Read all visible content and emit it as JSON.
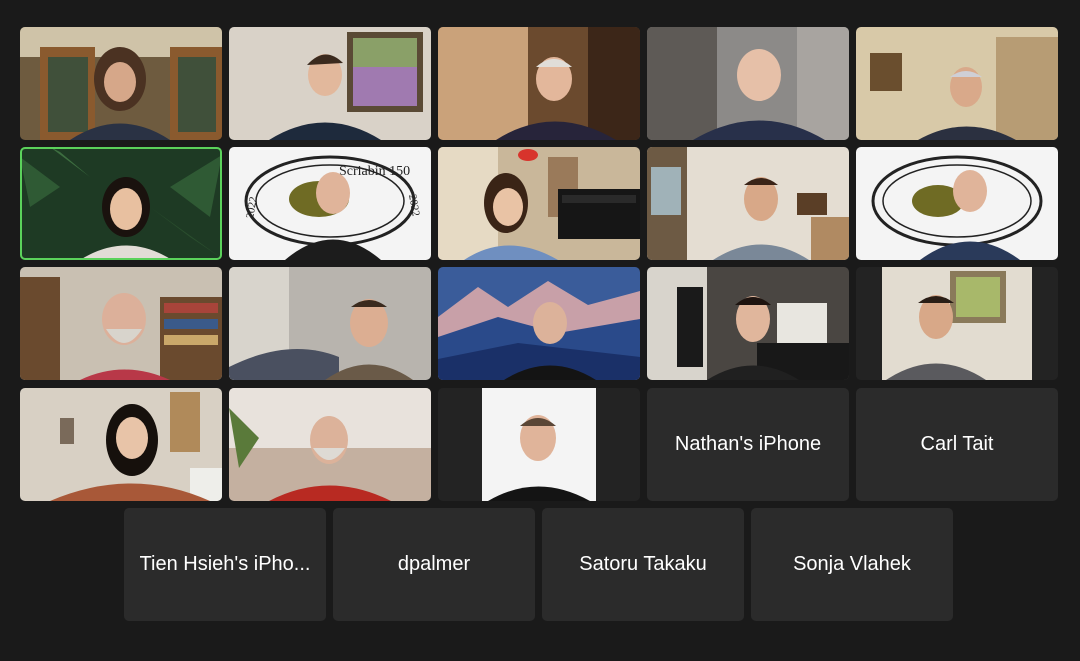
{
  "meeting": {
    "video_tiles": [
      {
        "id": "v1",
        "subject": "young man with curly hair on phone"
      },
      {
        "id": "v2",
        "subject": "young man in front of painting"
      },
      {
        "id": "v3",
        "subject": "elderly man with glasses"
      },
      {
        "id": "v4",
        "subject": "bald man with glasses"
      },
      {
        "id": "v5",
        "subject": "elderly man in hallway"
      },
      {
        "id": "v6",
        "subject": "woman with glasses, palm background",
        "active_speaker": true
      },
      {
        "id": "v7",
        "subject": "man with glasses, Scriabin 150 logo background"
      },
      {
        "id": "v8",
        "subject": "woman with grand piano"
      },
      {
        "id": "v9",
        "subject": "bearded man in room"
      },
      {
        "id": "v10",
        "subject": "man, Scriabin 150 logo background"
      },
      {
        "id": "v11",
        "subject": "bearded man with bookshelves"
      },
      {
        "id": "v12",
        "subject": "man with glasses and beard"
      },
      {
        "id": "v13",
        "subject": "man with mountain painting background"
      },
      {
        "id": "v14",
        "subject": "man in front of piano"
      },
      {
        "id": "v15",
        "subject": "man in front of framed picture"
      },
      {
        "id": "v16",
        "subject": "woman with long dark hair"
      },
      {
        "id": "v17",
        "subject": "bearded man in red sweater"
      },
      {
        "id": "v18",
        "subject": "man with glasses, white background"
      }
    ],
    "name_tiles": [
      {
        "label": "Nathan's iPhone"
      },
      {
        "label": "Carl Tait"
      },
      {
        "label": "Tien Hsieh's iPho..."
      },
      {
        "label": "dpalmer"
      },
      {
        "label": "Satoru Takaku"
      },
      {
        "label": "Sonja Vlahek"
      }
    ],
    "logo_text": "Scriabin 150",
    "logo_years": [
      "2022",
      "2022"
    ],
    "colors": {
      "background": "#1a1a1a",
      "tile": "#2b2b2b",
      "active_border": "#5bd25b"
    }
  }
}
